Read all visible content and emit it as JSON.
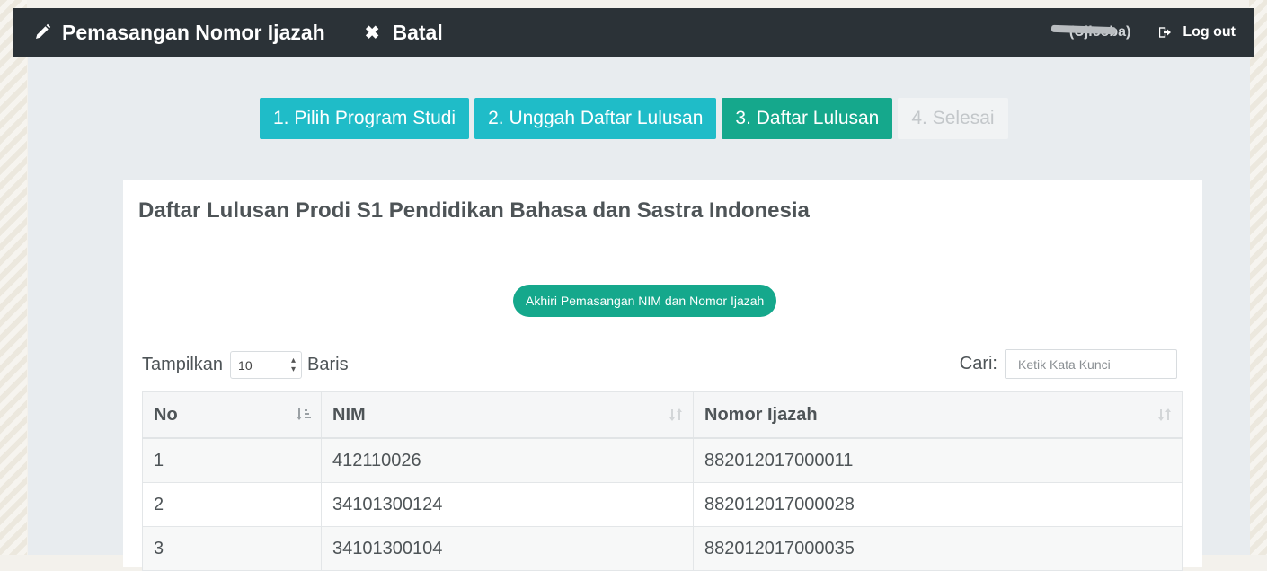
{
  "header": {
    "title": "Pemasangan Nomor Ijazah",
    "cancel_label": "Batal",
    "user_label": "(Ujicoba)",
    "logout_label": "Log out"
  },
  "steps": [
    {
      "label": "1. Pilih Program Studi",
      "state": "done"
    },
    {
      "label": "2. Unggah Daftar Lulusan",
      "state": "done"
    },
    {
      "label": "3. Daftar Lulusan",
      "state": "active"
    },
    {
      "label": "4. Selesai",
      "state": "disabled"
    }
  ],
  "panel": {
    "title": "Daftar Lulusan Prodi S1 Pendidikan Bahasa dan Sastra Indonesia",
    "end_button": "Akhiri Pemasangan NIM dan Nomor Ijazah"
  },
  "table_controls": {
    "show_label": "Tampilkan",
    "show_value": "10",
    "rows_label": "Baris",
    "search_label": "Cari:",
    "search_placeholder": "Ketik Kata Kunci"
  },
  "table": {
    "headers": [
      "No",
      "NIM",
      "Nomor Ijazah"
    ],
    "rows": [
      [
        "1",
        "412110026",
        "882012017000011"
      ],
      [
        "2",
        "34101300124",
        "882012017000028"
      ],
      [
        "3",
        "34101300104",
        "882012017000035"
      ]
    ]
  },
  "colors": {
    "topbar": "#2b3237",
    "step_done": "#1fbcc8",
    "step_active": "#15a88c",
    "button": "#15a88c"
  }
}
